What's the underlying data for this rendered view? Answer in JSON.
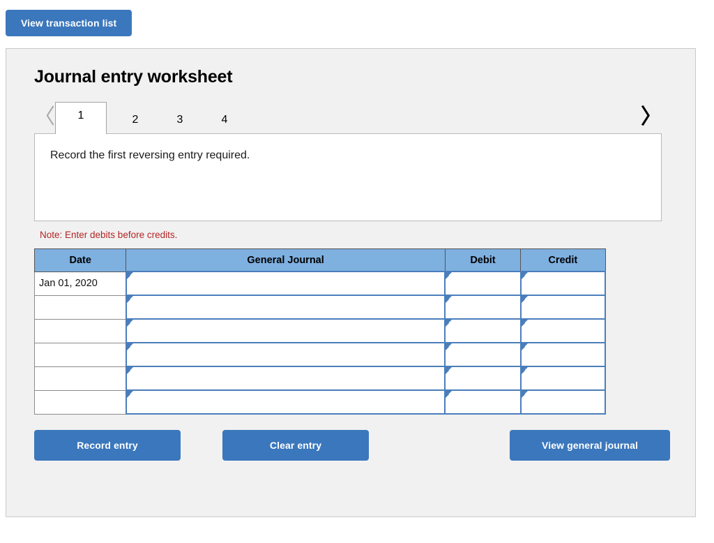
{
  "top": {
    "transaction_list_label": "View transaction list"
  },
  "worksheet": {
    "title": "Journal entry worksheet",
    "prev_icon": "chevron-left-icon",
    "next_icon": "chevron-right-icon",
    "prev_glyph": "〈",
    "next_glyph": "〉",
    "tabs": [
      {
        "label": "1",
        "active": true
      },
      {
        "label": "2",
        "active": false
      },
      {
        "label": "3",
        "active": false
      },
      {
        "label": "4",
        "active": false
      }
    ],
    "instruction": "Record the first reversing entry required.",
    "note": "Note: Enter debits before credits."
  },
  "table": {
    "headers": [
      "Date",
      "General Journal",
      "Debit",
      "Credit"
    ],
    "rows": [
      {
        "date": "Jan 01, 2020",
        "general_journal": "",
        "debit": "",
        "credit": ""
      },
      {
        "date": "",
        "general_journal": "",
        "debit": "",
        "credit": ""
      },
      {
        "date": "",
        "general_journal": "",
        "debit": "",
        "credit": ""
      },
      {
        "date": "",
        "general_journal": "",
        "debit": "",
        "credit": ""
      },
      {
        "date": "",
        "general_journal": "",
        "debit": "",
        "credit": ""
      },
      {
        "date": "",
        "general_journal": "",
        "debit": "",
        "credit": ""
      }
    ]
  },
  "actions": {
    "record_label": "Record entry",
    "clear_label": "Clear entry",
    "view_journal_label": "View general journal"
  },
  "colors": {
    "button_blue": "#3b77bc",
    "header_blue": "#7eb0e0",
    "input_border_blue": "#4a7ebb",
    "note_red": "#b32424",
    "panel_bg": "#f1f1f1"
  }
}
